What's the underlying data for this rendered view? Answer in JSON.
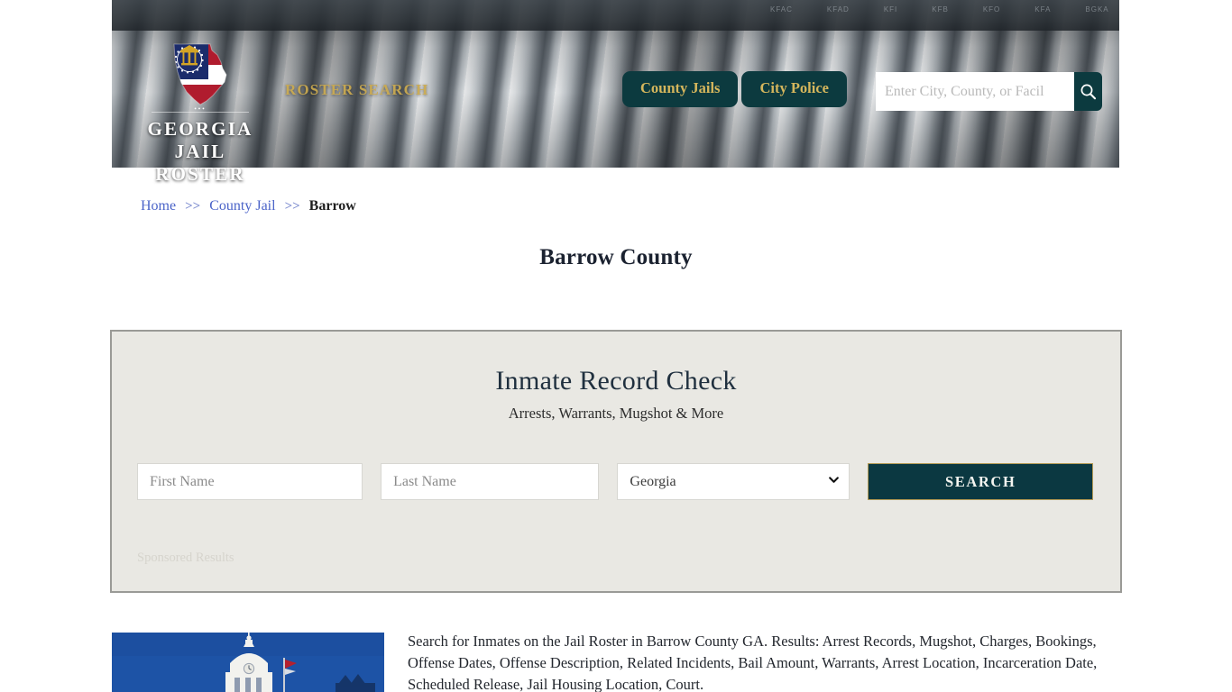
{
  "site": {
    "logo_line1": "GEORGIA",
    "logo_line2": "JAIL ROSTER",
    "logo_icon": "georgia-state-flag-icon",
    "tagline": "ROSTER SEARCH",
    "nav": [
      {
        "label": "County Jails"
      },
      {
        "label": "City Police"
      }
    ],
    "search": {
      "placeholder": "Enter City, County, or Facil",
      "value": "",
      "button_icon": "search-icon"
    },
    "shelf_labels": [
      "KFAC",
      "KFAD",
      "KFI",
      "KFB",
      "KFO",
      "KFA",
      "BGKA"
    ]
  },
  "breadcrumb": {
    "home": "Home",
    "sep1": ">>",
    "county_jail": "County Jail",
    "sep2": ">>",
    "current": "Barrow"
  },
  "page": {
    "title": "Barrow County"
  },
  "panel": {
    "title": "Inmate Record Check",
    "subtitle": "Arrests, Warrants, Mugshot & More",
    "first_name_placeholder": "First Name",
    "first_name_value": "",
    "last_name_placeholder": "Last Name",
    "last_name_value": "",
    "state_selected": "Georgia",
    "state_options": [
      "Georgia"
    ],
    "search_button": "SEARCH",
    "sponsored_label": "Sponsored Results"
  },
  "content": {
    "thumbnail_alt": "barrow-county-courthouse-photo",
    "description": "Search for Inmates on the Jail Roster in Barrow County GA. Results: Arrest Records, Mugshot, Charges, Bookings, Offense Dates, Offense Description, Related Incidents, Bail Amount, Warrants, Arrest Location, Incarceration Date, Scheduled Release, Jail Housing Location, Court."
  },
  "colors": {
    "teal": "#0c3a3f",
    "gold": "#d5b65c",
    "link_blue": "#4a63c8",
    "panel_bg": "#e9e8e3",
    "panel_border": "#9a9a96"
  }
}
